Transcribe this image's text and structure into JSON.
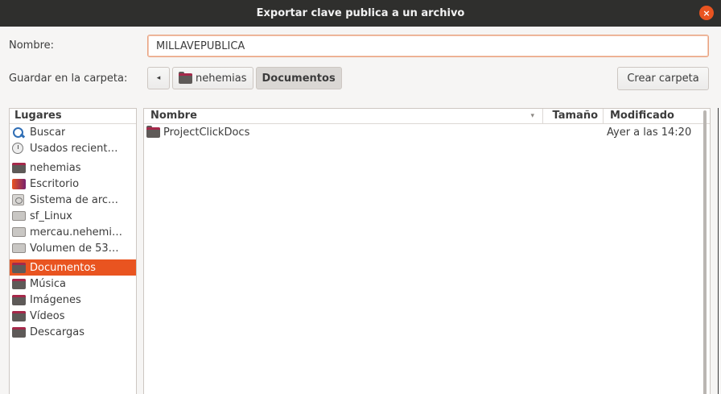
{
  "window": {
    "title": "Exportar clave publica a un archivo",
    "close_symbol": "×"
  },
  "form": {
    "name_label": "Nombre:",
    "name_value": "MILLAVEPUBLICA",
    "folder_label": "Guardar en la carpeta:"
  },
  "pathbar": {
    "back_symbol": "◂",
    "crumbs": [
      {
        "label": "nehemias",
        "icon": "folder-icon"
      },
      {
        "label": "Documentos",
        "icon": null,
        "active": true
      }
    ]
  },
  "create_folder_label": "Crear carpeta",
  "places": {
    "header": "Lugares",
    "items": [
      {
        "label": "Buscar",
        "icon": "search-icon"
      },
      {
        "label": "Usados recient…",
        "icon": "recent-icon"
      },
      {
        "label": "nehemias",
        "icon": "home-folder-icon"
      },
      {
        "label": "Escritorio",
        "icon": "desktop-icon"
      },
      {
        "label": "Sistema de arc…",
        "icon": "filesystem-icon"
      },
      {
        "label": "sf_Linux",
        "icon": "drive-icon"
      },
      {
        "label": "mercau.nehemi…",
        "icon": "drive-icon"
      },
      {
        "label": "Volumen de 53…",
        "icon": "drive-icon"
      },
      {
        "label": "Documentos",
        "icon": "folder-icon",
        "selected": true
      },
      {
        "label": "Música",
        "icon": "folder-icon"
      },
      {
        "label": "Imágenes",
        "icon": "folder-icon"
      },
      {
        "label": "Vídeos",
        "icon": "folder-icon"
      },
      {
        "label": "Descargas",
        "icon": "folder-icon"
      }
    ]
  },
  "files": {
    "columns": {
      "name": "Nombre",
      "size": "Tamaño",
      "modified": "Modificado"
    },
    "sort_indicator": "▾",
    "rows": [
      {
        "name": "ProjectClickDocs",
        "size": "",
        "modified": "Ayer a las 14:20"
      }
    ]
  },
  "colors": {
    "accent": "#e95420",
    "titlebar": "#2f2f2d"
  }
}
